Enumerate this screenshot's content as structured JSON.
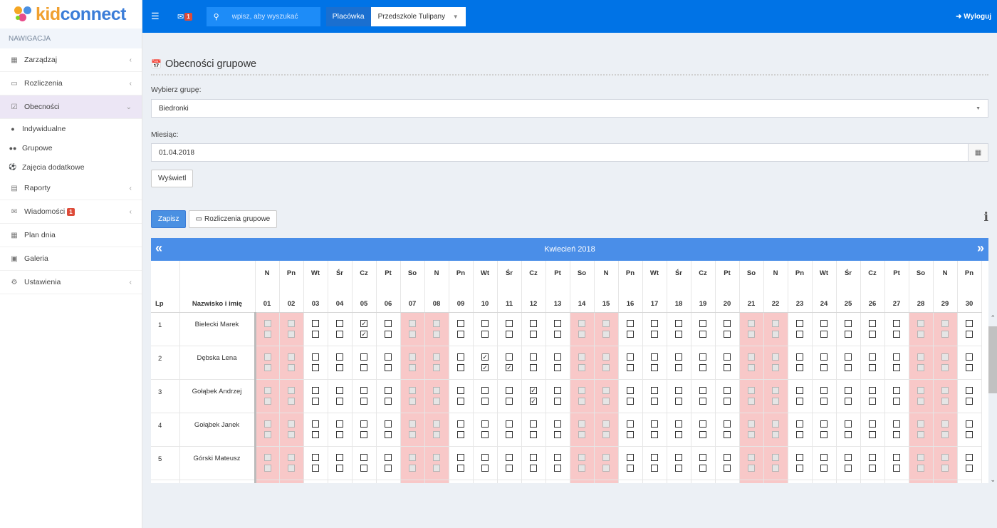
{
  "brand": {
    "kid": "kid",
    "connect": "connect"
  },
  "topbar": {
    "mail_badge": "1",
    "search_placeholder": "wpisz, aby wyszukać",
    "placowka_label": "Placówka",
    "placowka_value": "Przedszkole Tulipany",
    "logout_label": "Wyloguj"
  },
  "sidebar": {
    "header": "NAWIGACJA",
    "items": [
      {
        "label": "Zarządzaj",
        "icon": "building-icon"
      },
      {
        "label": "Rozliczenia",
        "icon": "credit-card-icon"
      },
      {
        "label": "Obecności",
        "icon": "calendar-check-icon"
      },
      {
        "label": "Raporty",
        "icon": "id-card-icon"
      },
      {
        "label": "Wiadomości",
        "icon": "envelope-icon",
        "badge": "1"
      },
      {
        "label": "Plan dnia",
        "icon": "calendar-icon"
      },
      {
        "label": "Galeria",
        "icon": "image-icon"
      },
      {
        "label": "Ustawienia",
        "icon": "gear-icon"
      }
    ],
    "subitems": [
      {
        "label": "Indywidualne",
        "icon": "user-icon"
      },
      {
        "label": "Grupowe",
        "icon": "users-icon"
      },
      {
        "label": "Zajęcia dodatkowe",
        "icon": "ball-icon"
      }
    ]
  },
  "main": {
    "title": "Obecności grupowe",
    "group_label": "Wybierz grupę:",
    "group_value": "Biedronki",
    "month_label": "Miesiąc:",
    "month_value": "01.04.2018",
    "show_button": "Wyświetl",
    "save_button": "Zapisz",
    "billing_button": "Rozliczenia grupowe",
    "info_icon": "i"
  },
  "calendar": {
    "month_title": "Kwiecień 2018",
    "prev": "«",
    "next": "»",
    "col_lp": "Lp",
    "col_name": "Nazwisko i imię",
    "days": [
      {
        "num": "01",
        "name": "N",
        "red": true,
        "weekend": true
      },
      {
        "num": "02",
        "name": "Pn",
        "red": false,
        "weekend": true
      },
      {
        "num": "03",
        "name": "Wt",
        "red": false,
        "weekend": false
      },
      {
        "num": "04",
        "name": "Śr",
        "red": false,
        "weekend": false
      },
      {
        "num": "05",
        "name": "Cz",
        "red": false,
        "weekend": false
      },
      {
        "num": "06",
        "name": "Pt",
        "red": false,
        "weekend": false
      },
      {
        "num": "07",
        "name": "So",
        "red": false,
        "weekend": true
      },
      {
        "num": "08",
        "name": "N",
        "red": true,
        "weekend": true
      },
      {
        "num": "09",
        "name": "Pn",
        "red": false,
        "weekend": false
      },
      {
        "num": "10",
        "name": "Wt",
        "red": false,
        "weekend": false
      },
      {
        "num": "11",
        "name": "Śr",
        "red": false,
        "weekend": false
      },
      {
        "num": "12",
        "name": "Cz",
        "red": false,
        "weekend": false
      },
      {
        "num": "13",
        "name": "Pt",
        "red": false,
        "weekend": false
      },
      {
        "num": "14",
        "name": "So",
        "red": false,
        "weekend": true
      },
      {
        "num": "15",
        "name": "N",
        "red": true,
        "weekend": true
      },
      {
        "num": "16",
        "name": "Pn",
        "red": false,
        "weekend": false
      },
      {
        "num": "17",
        "name": "Wt",
        "red": false,
        "weekend": false
      },
      {
        "num": "18",
        "name": "Śr",
        "red": false,
        "weekend": false
      },
      {
        "num": "19",
        "name": "Cz",
        "red": false,
        "weekend": false
      },
      {
        "num": "20",
        "name": "Pt",
        "red": false,
        "weekend": false
      },
      {
        "num": "21",
        "name": "So",
        "red": false,
        "weekend": true
      },
      {
        "num": "22",
        "name": "N",
        "red": true,
        "weekend": true
      },
      {
        "num": "23",
        "name": "Pn",
        "red": false,
        "weekend": false
      },
      {
        "num": "24",
        "name": "Wt",
        "red": false,
        "weekend": false
      },
      {
        "num": "25",
        "name": "Śr",
        "red": false,
        "weekend": false
      },
      {
        "num": "26",
        "name": "Cz",
        "red": false,
        "weekend": false
      },
      {
        "num": "27",
        "name": "Pt",
        "red": false,
        "weekend": false
      },
      {
        "num": "28",
        "name": "So",
        "red": false,
        "weekend": true
      },
      {
        "num": "29",
        "name": "N",
        "red": true,
        "weekend": true
      },
      {
        "num": "30",
        "name": "Pn",
        "red": false,
        "weekend": false
      }
    ],
    "students": [
      {
        "lp": "1",
        "name": "Bielecki Marek",
        "checked": [
          [
            5,
            0
          ],
          [
            5,
            1
          ]
        ]
      },
      {
        "lp": "2",
        "name": "Dębska Lena",
        "checked": [
          [
            10,
            0
          ],
          [
            10,
            1
          ],
          [
            11,
            1
          ]
        ]
      },
      {
        "lp": "3",
        "name": "Gołąbek Andrzej",
        "checked": [
          [
            12,
            0
          ],
          [
            12,
            1
          ]
        ]
      },
      {
        "lp": "4",
        "name": "Gołąbek Janek",
        "checked": []
      },
      {
        "lp": "5",
        "name": "Górski Mateusz",
        "checked": []
      },
      {
        "lp": "",
        "name": "",
        "checked": []
      }
    ]
  }
}
